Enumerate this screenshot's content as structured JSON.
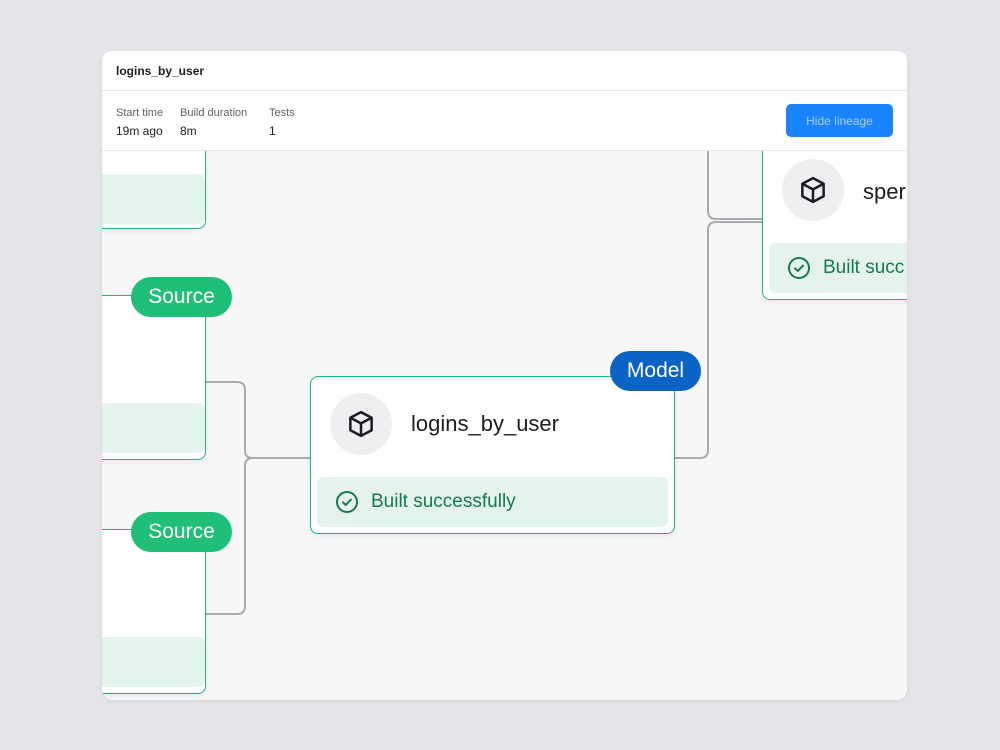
{
  "window": {
    "title": "logins_by_user"
  },
  "info": {
    "start_time": {
      "label": "Start time",
      "value": "19m ago"
    },
    "build_duration": {
      "label": "Build duration",
      "value": "8m"
    },
    "tests": {
      "label": "Tests",
      "value": "1"
    },
    "hide_lineage_label": "Hide lineage"
  },
  "lineage": {
    "main_node": {
      "type_label": "Model",
      "name": "logins_by_user",
      "status": "Built successfully",
      "icon": "cube-icon",
      "status_icon": "check-circle-icon"
    },
    "right_node": {
      "name": "sper",
      "status": "Built succ",
      "icon": "cube-icon",
      "status_icon": "check-circle-icon"
    },
    "source_nodes": [
      {
        "type_label": "Source"
      },
      {
        "type_label": "Source"
      }
    ]
  },
  "colors": {
    "accent_blue": "#1a84ff",
    "source_green": "#1fbf78",
    "model_blue": "#0b63c5",
    "status_green": "#177a4b",
    "status_bg": "#e4f3ec",
    "edge_gray": "#a9abb0"
  }
}
